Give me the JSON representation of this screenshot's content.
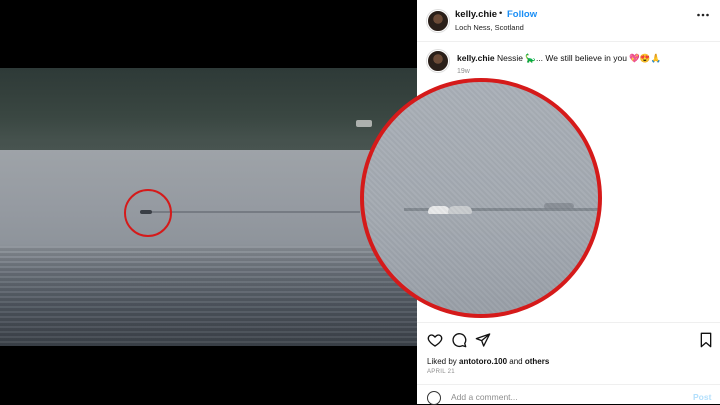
{
  "post": {
    "username": "kelly.chie",
    "separator": "•",
    "follow_label": "Follow",
    "location": "Loch Ness, Scotland",
    "more_icon": "more-horizontal-icon",
    "caption_text": "Nessie 🦕... We still believe in you 💖😍🙏",
    "caption_time": "19w",
    "liked_by_prefix": "Liked by ",
    "liked_by_user": "antotoro.100",
    "liked_by_suffix": " and ",
    "liked_by_others": "others",
    "date": "APRIL 21",
    "comment_placeholder": "Add a comment...",
    "post_label": "Post"
  },
  "icons": [
    "heart-icon",
    "comment-icon",
    "share-icon",
    "bookmark-icon",
    "emoji-icon"
  ],
  "colors": {
    "accent": "#1a8ef5",
    "highlight_circle": "#d51a1a"
  }
}
